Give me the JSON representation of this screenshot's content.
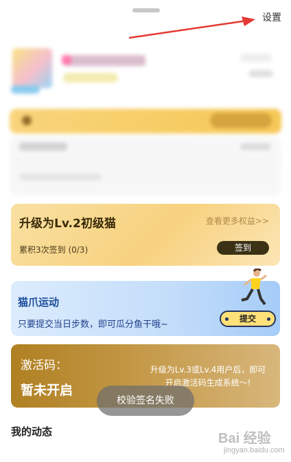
{
  "header": {
    "settings_label": "设置"
  },
  "level_card": {
    "title": "升级为Lv.2初级猫",
    "more_link": "查看更多权益>>",
    "progress": "累积3次签到 (0/3)",
    "checkin_label": "签到"
  },
  "sport_card": {
    "title": "猫爪运动",
    "description": "只要提交当日步数，即可瓜分鱼干哦~",
    "submit_label": "提交"
  },
  "activation_card": {
    "title": "激活码：",
    "status": "暂未开启",
    "description": "升级为Lv.3或Lv.4用户后，即可开启激活码生成系统～!"
  },
  "toast": {
    "message": "校验签名失败"
  },
  "section": {
    "my_activity": "我的动态"
  },
  "watermark": {
    "text": "Bai 经验",
    "sub": "jingyan.baidu.com"
  },
  "colors": {
    "arrow": "#e53935",
    "level_card": "#f7d27f",
    "sport_card": "#c3ddfa",
    "activation_card": "#c39745",
    "checkin_button": "#3b3215"
  }
}
